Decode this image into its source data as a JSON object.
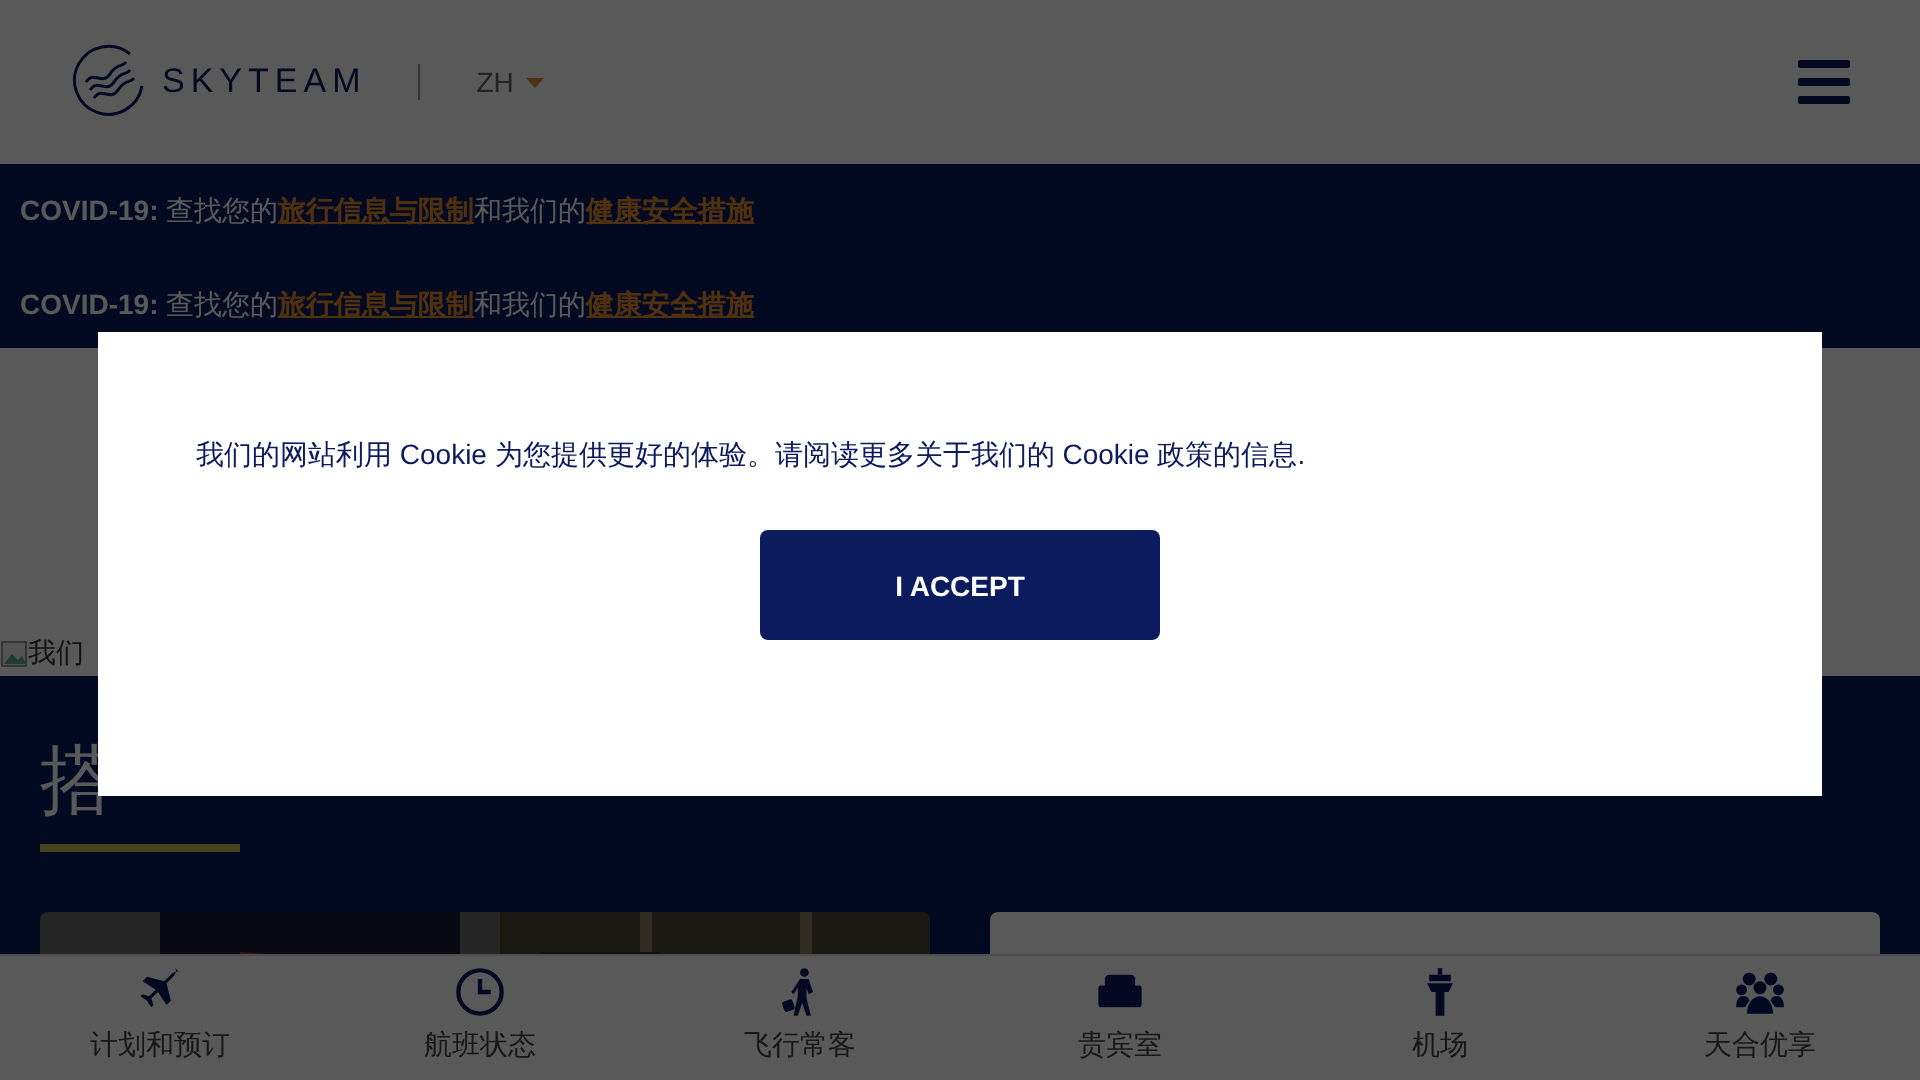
{
  "header": {
    "brand": "SKYTEAM",
    "language": "ZH"
  },
  "notices": [
    {
      "lead": "COVID-19:",
      "text_1": "查找您的",
      "link_1": "旅行信息与限制",
      "text_2": "和我们的",
      "link_2": "健康安全措施"
    },
    {
      "lead": "COVID-19:",
      "text_1": "查找您的",
      "link_1": "旅行信息与限制",
      "text_2": "和我们的",
      "link_2": "健康安全措施"
    }
  ],
  "broken_image_alt": "我们",
  "section": {
    "heading": "搭"
  },
  "bottom_nav": [
    {
      "label": "计划和预订",
      "kind": "plane"
    },
    {
      "label": "航班状态",
      "kind": "clock"
    },
    {
      "label": "飞行常客",
      "kind": "traveler"
    },
    {
      "label": "贵宾室",
      "kind": "sofa"
    },
    {
      "label": "机场",
      "kind": "tower"
    },
    {
      "label": "天合优享",
      "kind": "group"
    }
  ],
  "cookie_dialog": {
    "message": "我们的网站利用 Cookie 为您提供更好的体验。请阅读更多关于我们的 Cookie 政策的信息.",
    "button": "I ACCEPT"
  }
}
